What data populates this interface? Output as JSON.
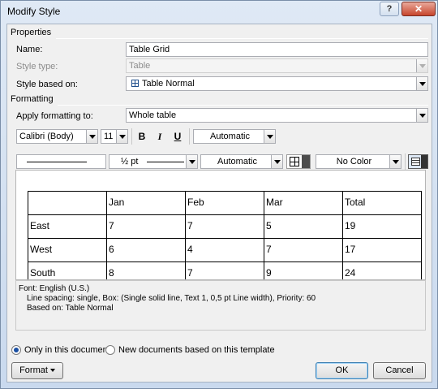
{
  "window": {
    "title": "Modify Style",
    "help_label": "?",
    "close_label": "✕"
  },
  "properties": {
    "section": "Properties",
    "name_label": "Name:",
    "name_value": "Table Grid",
    "style_type_label": "Style type:",
    "style_type_value": "Table",
    "based_on_label": "Style based on:",
    "based_on_value": "Table Normal"
  },
  "formatting": {
    "section": "Formatting",
    "apply_label": "Apply formatting to:",
    "apply_value": "Whole table",
    "font": "Calibri (Body)",
    "size": "11",
    "bold": "B",
    "italic": "I",
    "underline": "U",
    "font_color": "Automatic",
    "border_weight": "½ pt",
    "border_color": "Automatic",
    "shading": "No Color"
  },
  "preview": {
    "rows": [
      [
        "",
        "Jan",
        "Feb",
        "Mar",
        "Total"
      ],
      [
        "East",
        "7",
        "7",
        "5",
        "19"
      ],
      [
        "West",
        "6",
        "4",
        "7",
        "17"
      ],
      [
        "South",
        "8",
        "7",
        "9",
        "24"
      ]
    ]
  },
  "description": {
    "line1": "Font: English (U.S.)",
    "line2": "Line spacing:  single, Box: (Single solid line, Text 1,  0,5 pt Line width), Priority: 60",
    "line3": "Based on: Table Normal"
  },
  "options": {
    "only_this_doc": "Only in this document",
    "new_docs": "New documents based on this template"
  },
  "buttons": {
    "format": "Format",
    "ok": "OK",
    "cancel": "Cancel"
  }
}
